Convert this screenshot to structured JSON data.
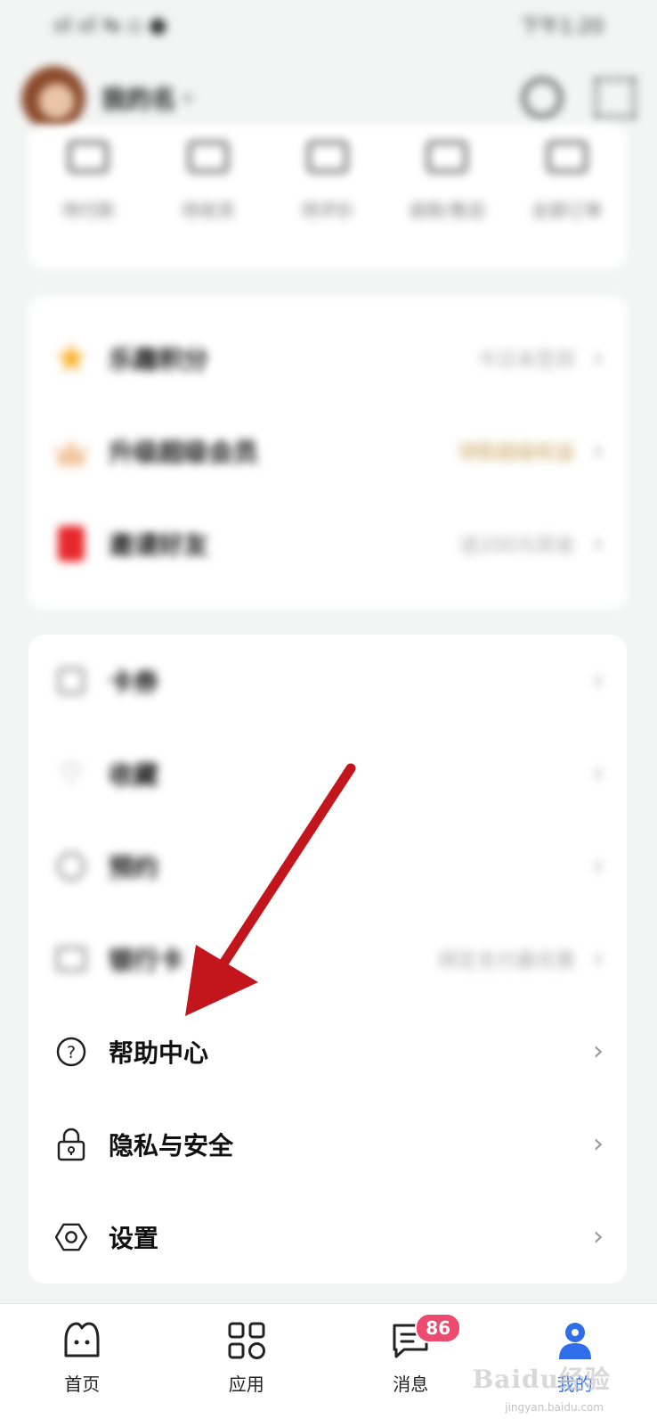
{
  "status_bar": {
    "signal": "ııl ııl ⇆ ▫ ●",
    "time": "下午1:20"
  },
  "profile": {
    "username": "我的名",
    "caret": "▾"
  },
  "orders": [
    {
      "label": "待付款"
    },
    {
      "label": "待收货"
    },
    {
      "label": "待评价"
    },
    {
      "label": "退款/售后"
    },
    {
      "label": "全部订单"
    }
  ],
  "benefits": [
    {
      "label": "乐趣积分",
      "value": "今日未签到"
    },
    {
      "label": "升级超级会员",
      "value": "领取超级权益"
    },
    {
      "label": "邀请好友",
      "value": "送200元现金"
    }
  ],
  "services": [
    {
      "label": "卡券",
      "value": ""
    },
    {
      "label": "收藏",
      "value": ""
    },
    {
      "label": "预约",
      "value": ""
    },
    {
      "label": "银行卡",
      "value": "绑定支付最优惠"
    },
    {
      "label": "帮助中心",
      "value": ""
    },
    {
      "label": "隐私与安全",
      "value": ""
    },
    {
      "label": "设置",
      "value": ""
    }
  ],
  "chevron": "›",
  "nav": {
    "items": [
      {
        "label": "首页",
        "icon": "home-icon"
      },
      {
        "label": "应用",
        "icon": "apps-grid-icon"
      },
      {
        "label": "消息",
        "icon": "message-icon",
        "badge": "86"
      },
      {
        "label": "我的",
        "icon": "profile-icon",
        "active": true
      }
    ]
  },
  "watermark": {
    "text": "Baidu经验",
    "sub": "jingyan.baidu.com"
  },
  "colors": {
    "accent": "#2f6ee8",
    "badge": "#ec4a6e",
    "arrow": "#c3161c"
  }
}
